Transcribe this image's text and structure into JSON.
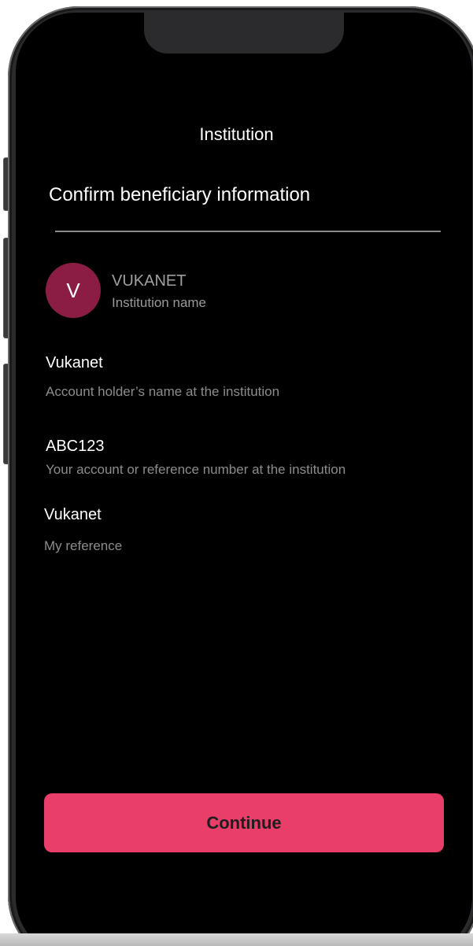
{
  "header": {
    "title": "Institution"
  },
  "main": {
    "confirm_title": "Confirm beneficiary information",
    "institution": {
      "avatar_letter": "V",
      "avatar_color": "#8b1d45",
      "name": "VUKANET",
      "caption": "Institution name"
    },
    "fields": [
      {
        "value": "Vukanet",
        "label": "Account holder’s name at the institution"
      },
      {
        "value": "ABC123",
        "label": "Your account or reference number at the institution"
      },
      {
        "value": "Vukanet",
        "label": "My reference"
      }
    ]
  },
  "footer": {
    "continue_label": "Continue",
    "continue_color": "#e83e69"
  }
}
